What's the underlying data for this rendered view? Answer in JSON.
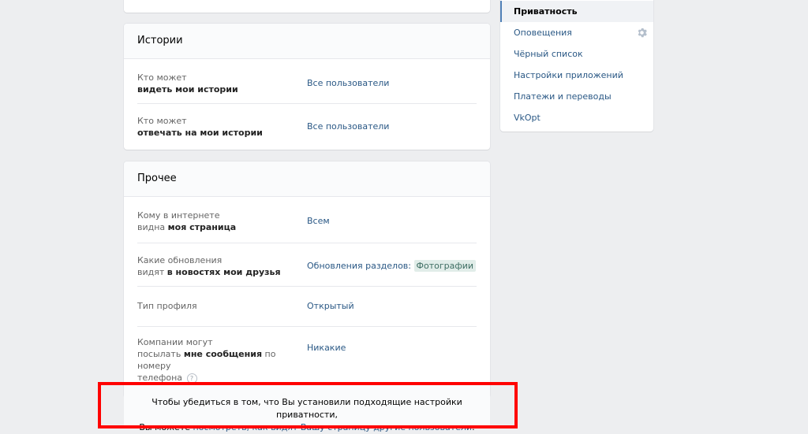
{
  "stories": {
    "title": "Истории",
    "rows": [
      {
        "label_pre": "Кто может",
        "label_bold": "видеть мои истории",
        "label_post": "",
        "value": "Все пользователи"
      },
      {
        "label_pre": "Кто может",
        "label_bold": "отвечать на мои истории",
        "label_post": "",
        "value": "Все пользователи"
      }
    ]
  },
  "other": {
    "title": "Прочее",
    "rows": [
      {
        "label_pre": "Кому в интернете",
        "label_mid": "видна ",
        "label_bold": "моя страница",
        "value": "Всем"
      },
      {
        "label_pre": "Какие обновления",
        "label_mid": "видят ",
        "label_bold": "в новостях мои друзья",
        "value_prefix": "Обновления разделов:",
        "value_highlight": "Фотографии"
      },
      {
        "label_pre": "Тип профиля",
        "value": "Открытый"
      },
      {
        "label_pre": "Компании могут",
        "label_mid": "посылать ",
        "label_bold": "мне сообщения",
        "label_post": " по номеру",
        "label_line3": "телефона",
        "help": "?",
        "value": "Никакие"
      }
    ]
  },
  "notice": {
    "line1": "Чтобы убедиться в том, что Вы установили подходящие настройки приватности,",
    "line2_pre": "Вы можете ",
    "line2_link": "посмотреть, как видят Вашу страницу другие пользователи",
    "line2_post": "."
  },
  "menu": {
    "items": [
      {
        "label": "Приватность",
        "active": true
      },
      {
        "label": "Оповещения",
        "icon": "gear-icon"
      },
      {
        "label": "Чёрный список"
      },
      {
        "label": "Настройки приложений"
      },
      {
        "label": "Платежи и переводы"
      },
      {
        "label": "VkOpt"
      }
    ]
  },
  "colors": {
    "link": "#2a5885",
    "highlight_bg": "#e1ede9",
    "annotation": "#ff0000"
  }
}
